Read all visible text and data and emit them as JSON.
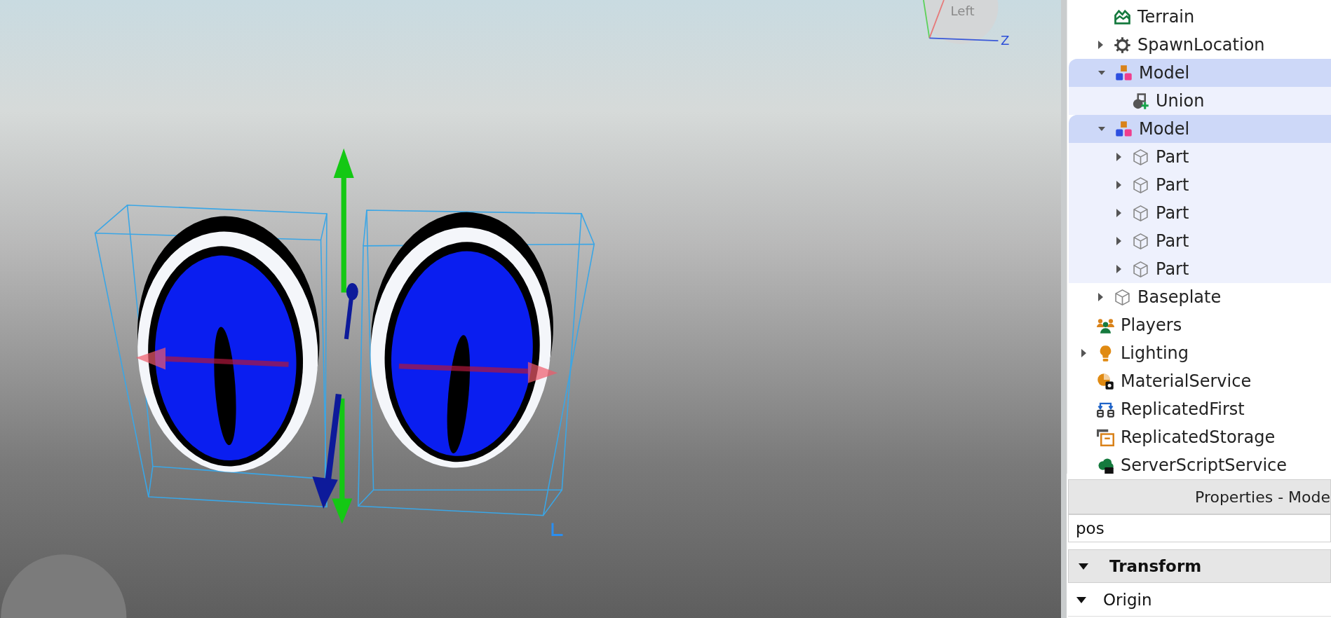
{
  "viewport": {
    "view_cube_label": "Left",
    "axis_label": "Z"
  },
  "explorer": {
    "workspace_children": [
      {
        "label": "Terrain",
        "kind": "terrain",
        "expandable": false,
        "selected": false
      },
      {
        "label": "SpawnLocation",
        "kind": "spawn",
        "expandable": true,
        "expanded": false,
        "selected": false
      },
      {
        "label": "Model",
        "kind": "model",
        "expandable": true,
        "expanded": true,
        "selected": true,
        "children": [
          {
            "label": "Union",
            "kind": "union",
            "expandable": false,
            "selected": false
          }
        ]
      },
      {
        "label": "Model",
        "kind": "model",
        "expandable": true,
        "expanded": true,
        "selected": true,
        "children": [
          {
            "label": "Part",
            "kind": "part",
            "expandable": true,
            "expanded": false,
            "selected": false
          },
          {
            "label": "Part",
            "kind": "part",
            "expandable": true,
            "expanded": false,
            "selected": false
          },
          {
            "label": "Part",
            "kind": "part",
            "expandable": true,
            "expanded": false,
            "selected": false
          },
          {
            "label": "Part",
            "kind": "part",
            "expandable": true,
            "expanded": false,
            "selected": false
          },
          {
            "label": "Part",
            "kind": "part",
            "expandable": true,
            "expanded": false,
            "selected": false
          }
        ]
      },
      {
        "label": "Baseplate",
        "kind": "part",
        "expandable": true,
        "expanded": false,
        "selected": false
      }
    ],
    "services": [
      {
        "label": "Players",
        "kind": "players",
        "expandable": false,
        "selected": false
      },
      {
        "label": "Lighting",
        "kind": "lighting",
        "expandable": true,
        "expanded": false,
        "selected": false
      },
      {
        "label": "MaterialService",
        "kind": "material",
        "expandable": false,
        "selected": false
      },
      {
        "label": "ReplicatedFirst",
        "kind": "replicated-first",
        "expandable": false,
        "selected": false
      },
      {
        "label": "ReplicatedStorage",
        "kind": "replicated-storage",
        "expandable": false,
        "selected": false
      },
      {
        "label": "ServerScriptService",
        "kind": "server-script",
        "expandable": false,
        "selected": false
      }
    ]
  },
  "properties": {
    "title": "Properties - Mode",
    "search": {
      "value": "pos"
    },
    "rows": [
      {
        "kind": "category",
        "label": "Transform",
        "expanded": true
      },
      {
        "kind": "property",
        "label": "Origin",
        "expanded": true
      }
    ]
  }
}
